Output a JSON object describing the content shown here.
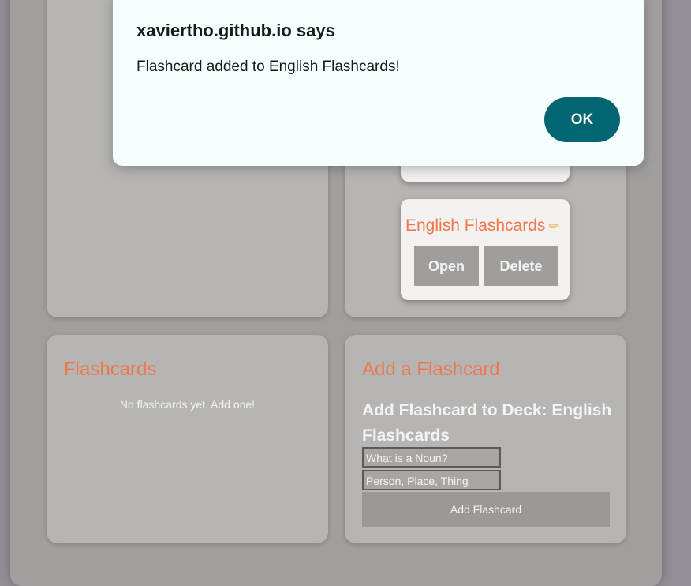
{
  "dialog": {
    "title": "xaviertho.github.io says",
    "message": "Flashcard added to English Flashcards!",
    "ok_label": "OK"
  },
  "decks": {
    "items": [
      {
        "title": "English Flashcards",
        "open_label": "Open",
        "delete_label": "Delete",
        "edit_icon": "pencil-icon"
      }
    ]
  },
  "flashcards": {
    "title": "Flashcards",
    "empty_text": "No flashcards yet. Add one!"
  },
  "add_flashcard": {
    "title": "Add a Flashcard",
    "subheading": "Add Flashcard to Deck: English Flashcards",
    "question_value": "What is a Noun?",
    "answer_value": "Person, Place, Thing",
    "button_label": "Add Flashcard"
  },
  "colors": {
    "accent": "#f0774b",
    "ok_button": "#026672",
    "overlay": "#918f95"
  }
}
